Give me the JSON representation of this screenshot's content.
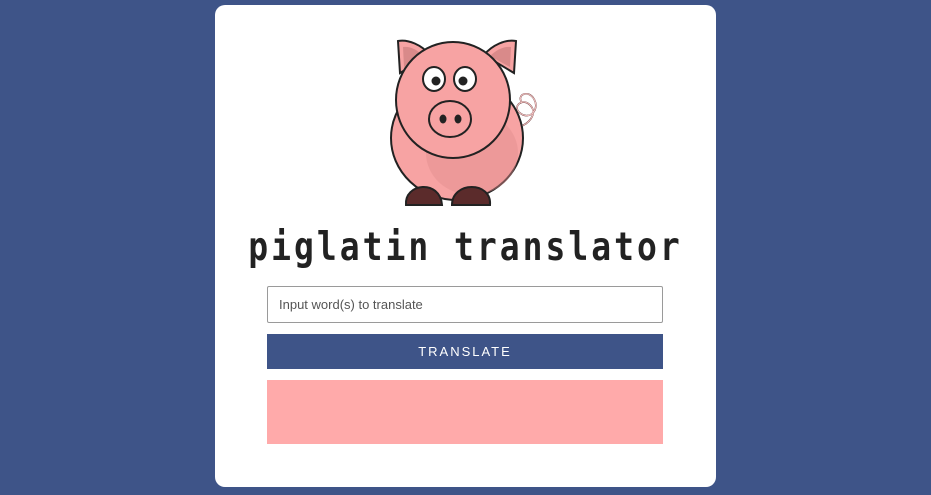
{
  "app": {
    "title": "piglatin translator"
  },
  "input": {
    "placeholder": "Input word(s) to translate",
    "value": ""
  },
  "translate_button": {
    "label": "TRANSLATE"
  },
  "output": {
    "text": ""
  },
  "colors": {
    "background": "#3e5488",
    "button": "#3e5488",
    "output_box": "#ffaaaa",
    "pig_body": "#f7a3a3"
  },
  "icons": {
    "logo": "pig-mascot-icon"
  }
}
